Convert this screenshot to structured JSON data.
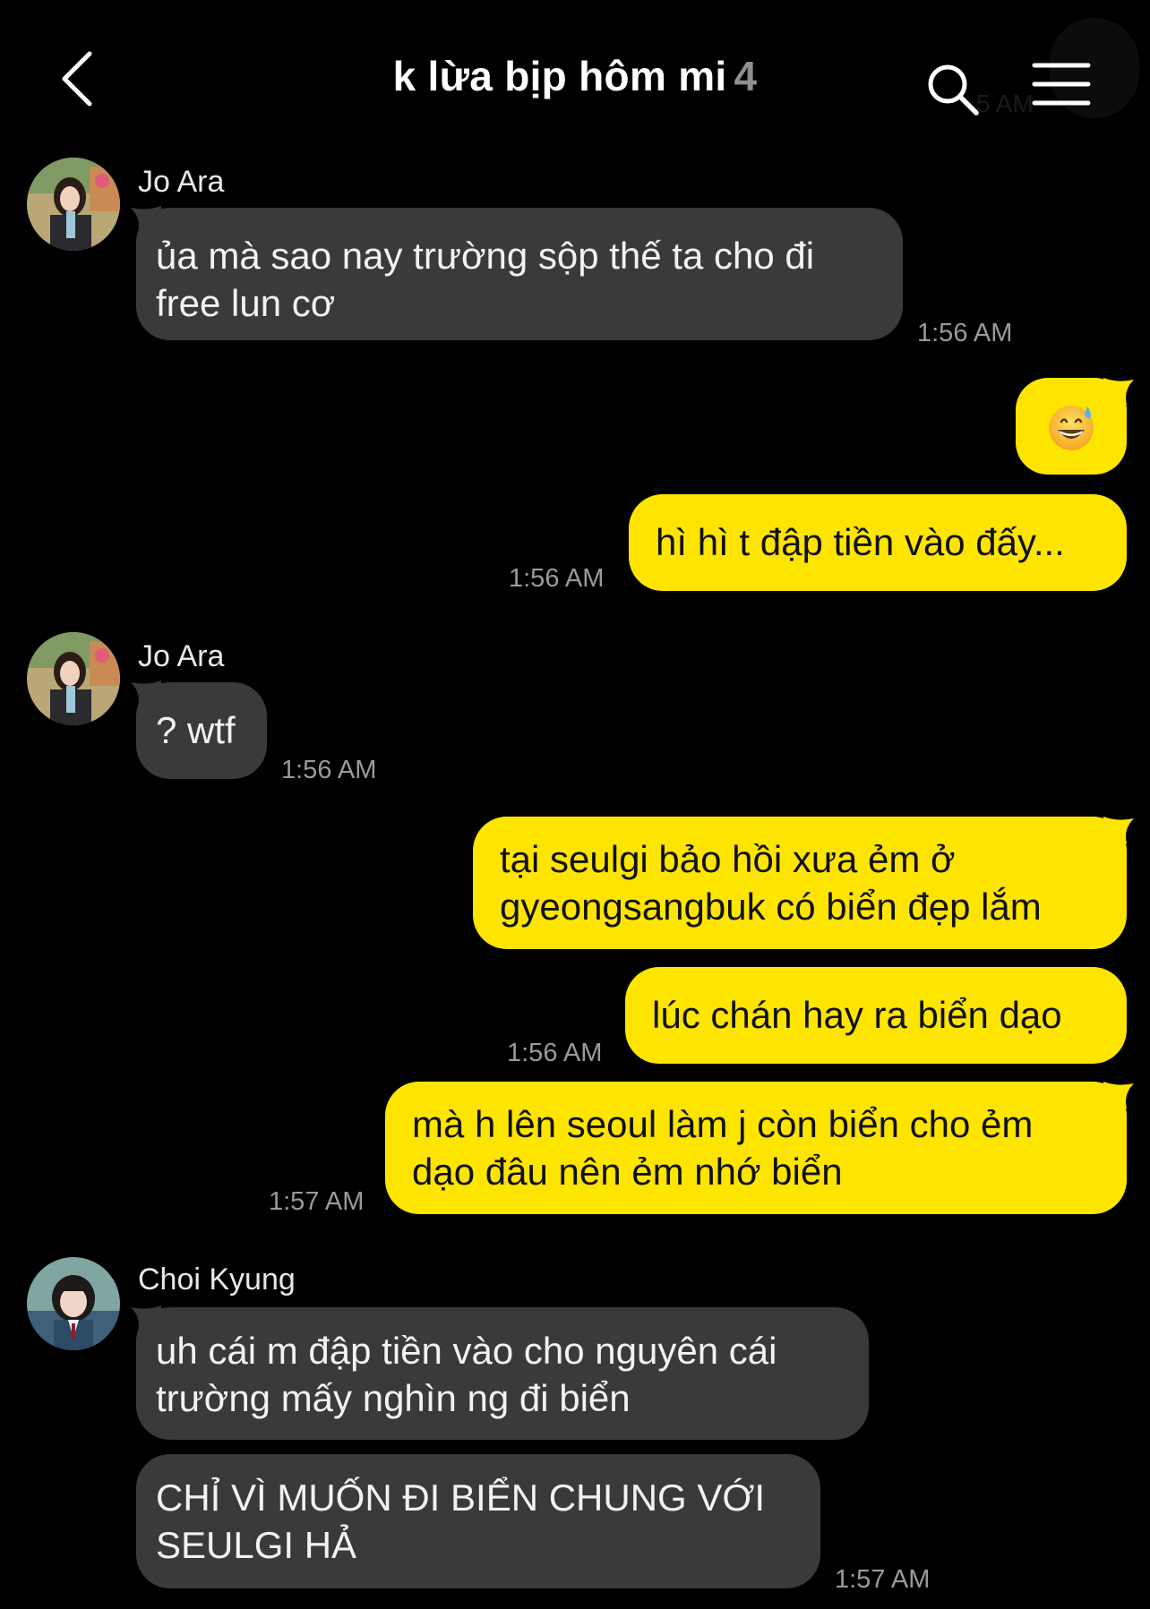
{
  "header": {
    "back_icon": "chevron-left-icon",
    "title": "k lừa bịp hôm mi",
    "member_count": "4",
    "search_icon": "search-icon",
    "menu_icon": "hamburger-menu-icon",
    "ghost_time": "5 AM"
  },
  "colors": {
    "background": "#000000",
    "incoming_bubble": "#3a3a3c",
    "outgoing_bubble": "#fee500",
    "timestamp": "#9a9a9a"
  },
  "messages": [
    {
      "sender": "Jo Ara",
      "text": "ủa mà sao nay trường sộp thế ta cho đi\nfree lun cơ",
      "time": "1:56 AM"
    },
    {
      "text": "😅"
    },
    {
      "text": "hì hì t đập tiền vào đấy...",
      "time": "1:56 AM"
    },
    {
      "sender": "Jo Ara",
      "text": "? wtf",
      "time": "1:56 AM"
    },
    {
      "text": "tại seulgi bảo hồi xưa ẻm ở\ngyeongsangbuk có biển đẹp lắm"
    },
    {
      "text": "lúc chán hay ra biển dạo",
      "time": "1:56 AM"
    },
    {
      "text": "mà h lên seoul làm j còn biển cho ẻm\ndạo đâu nên ẻm nhớ biển",
      "time": "1:57 AM"
    },
    {
      "sender": "Choi Kyung",
      "text": "uh cái m đập tiền vào cho nguyên cái\ntrường mấy nghìn ng đi biển"
    },
    {
      "text": "CHỈ VÌ MUỐN ĐI BIỂN CHUNG VỚI\nSEULGI HẢ",
      "time": "1:57 AM"
    }
  ]
}
